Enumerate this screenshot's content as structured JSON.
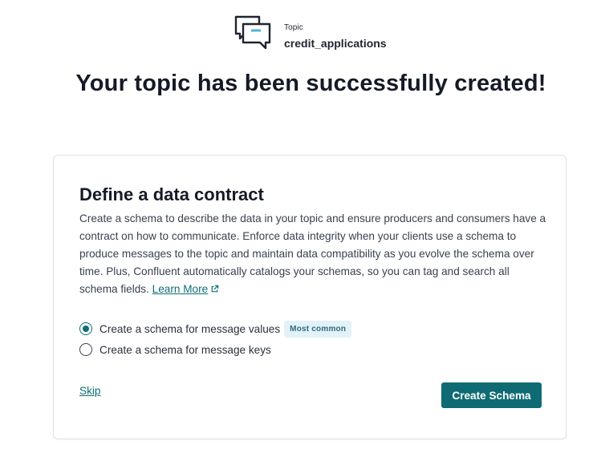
{
  "topic": {
    "label": "Topic",
    "name": "credit_applications",
    "icon": "chat-bubbles-icon"
  },
  "success": {
    "heading": "Your topic has been successfully created!"
  },
  "contract": {
    "title": "Define a data contract",
    "description": "Create a schema to describe the data in your topic and ensure producers and consumers have a contract on how to communicate. Enforce data integrity when your clients use a schema to produce messages to the topic and maintain data compatibility as you evolve the schema over time. Plus, Confluent automatically catalogs your schemas, so you can tag and search all schema fields.",
    "learn_more": "Learn More",
    "options": [
      {
        "label": "Create a schema for message values",
        "checked": true,
        "badge": "Most common"
      },
      {
        "label": "Create a schema for message keys",
        "checked": false
      }
    ],
    "skip_label": "Skip",
    "create_label": "Create Schema"
  },
  "colors": {
    "accent": "#0e6b73",
    "badge_bg": "#e3f2f7",
    "icon_highlight": "#4fb3d9"
  }
}
